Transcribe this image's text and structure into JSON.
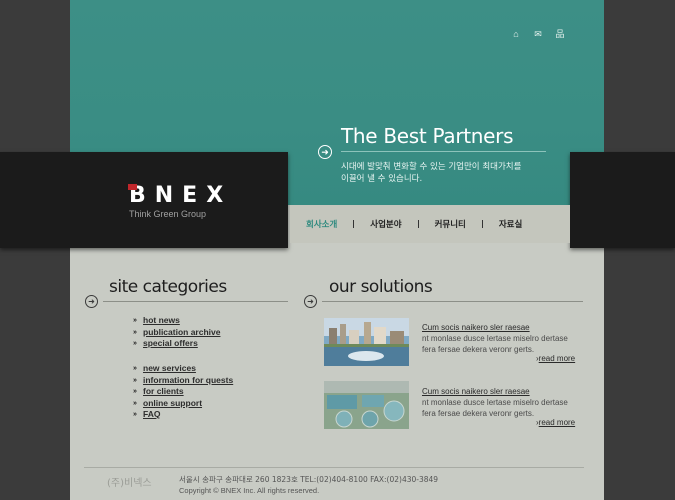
{
  "top_icons": [
    {
      "name": "home-icon",
      "glyph": "⌂"
    },
    {
      "name": "mail-icon",
      "glyph": "✉"
    },
    {
      "name": "sitemap-icon",
      "glyph": "品"
    }
  ],
  "hero": {
    "title": "The Best Partners",
    "subtitle_line1": "시대에 발맞춰 변화할 수 있는 기업만이 최대가치를",
    "subtitle_line2": "이끌어 낼 수 있습니다."
  },
  "logo": {
    "text": "BNEX",
    "tagline": "Think Green Group"
  },
  "nav": {
    "items": [
      {
        "label": "회사소개",
        "active": true
      },
      {
        "label": "사업분야",
        "active": false
      },
      {
        "label": "커뮤니티",
        "active": false
      },
      {
        "label": "자료실",
        "active": false
      }
    ]
  },
  "categories": {
    "title": "site categories",
    "group1": [
      "hot news",
      "publication archive",
      "special offers"
    ],
    "group2": [
      "new services",
      "information for quests",
      "for clients",
      "online support",
      "FAQ"
    ]
  },
  "solutions": {
    "title": "our solutions",
    "items": [
      {
        "title": "Cum socis naikero sler raesae",
        "desc": "nt monlase dusce lertase miselro dertase fera fersae dekera veronr gerts.",
        "more": "read more"
      },
      {
        "title": "Cum socis naikero sler raesae",
        "desc": "nt monlase dusce lertase miselro dertase fera fersae dekera veronr gerts.",
        "more": "read more"
      }
    ]
  },
  "footer": {
    "logo": "(주)비넥스",
    "address": "서울시 송파구 송파대로 260 1823호    TEL:(02)404-8100    FAX:(02)430-3849",
    "copyright": "Copyright © BNEX Inc.  All rights reserved."
  },
  "colors": {
    "hero_teal": "#3a8d84",
    "nav_active": "#2f8a7f",
    "logo_accent": "#c0262b"
  }
}
